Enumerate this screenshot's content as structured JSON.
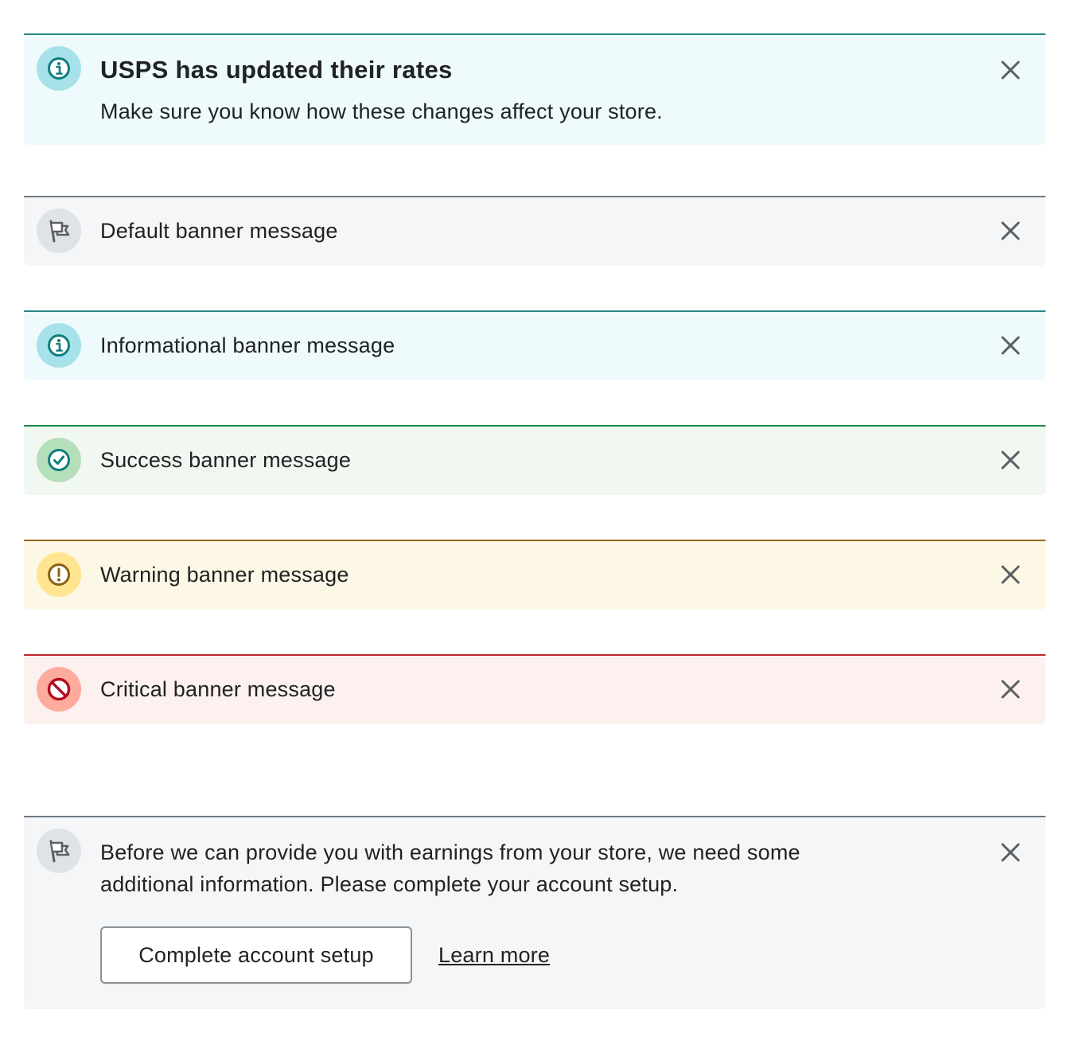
{
  "colors": {
    "info_accent": "#2b8785",
    "default_accent": "#6c7a85",
    "success_accent": "#1f8a4c",
    "warning_accent": "#9a6b20",
    "critical_accent": "#c1272d"
  },
  "banners": {
    "titled_info": {
      "icon": "info-circle-icon",
      "title": "USPS has updated their rates",
      "body": "Make sure you know how these changes affect your store."
    },
    "default": {
      "icon": "flag-icon",
      "message": "Default banner message"
    },
    "info": {
      "icon": "info-circle-icon",
      "message": "Informational banner message"
    },
    "success": {
      "icon": "check-circle-icon",
      "message": "Success banner message"
    },
    "warning": {
      "icon": "exclamation-circle-icon",
      "message": "Warning banner message"
    },
    "critical": {
      "icon": "prohibited-circle-icon",
      "message": "Critical banner message"
    },
    "action": {
      "icon": "flag-icon",
      "body": "Before we can provide you with earnings from your store, we need some additional information. Please complete your account setup.",
      "primary_action": "Complete account setup",
      "secondary_action": "Learn more"
    }
  }
}
